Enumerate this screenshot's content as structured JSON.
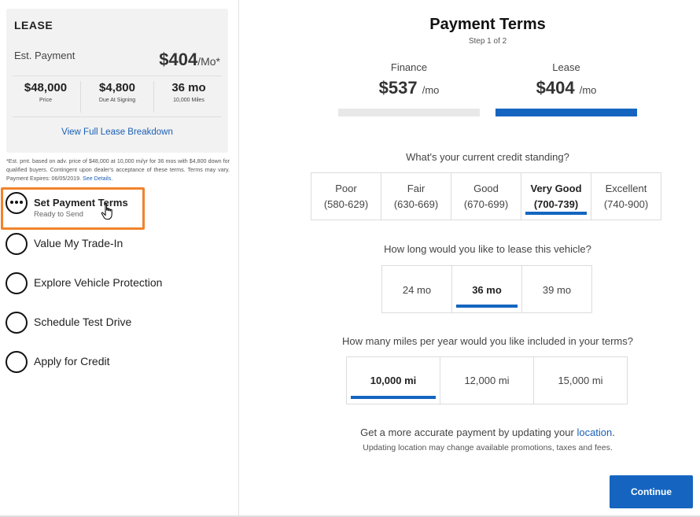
{
  "sidebar": {
    "card": {
      "title": "LEASE",
      "est_label": "Est. Payment",
      "est_value": "$404",
      "est_unit": "/Mo*",
      "stats": [
        {
          "value": "$48,000",
          "label": "Price"
        },
        {
          "value": "$4,800",
          "label": "Due At Signing"
        },
        {
          "value": "36 mo",
          "label": "10,000 Miles"
        }
      ],
      "breakdown_link": "View Full Lease Breakdown"
    },
    "disclaimer": "*Est. pmt. based on adv. price of $48,000 at 10,000 mi/yr for 36 mos with $4,800 down for qualified buyers. Contingent upon dealer's acceptance of these terms. Terms may vary. Payment Expires: 06/05/2019.",
    "disclaimer_link": "See Details.",
    "steps": [
      {
        "label": "Set Payment Terms",
        "sub": "Ready to Send"
      },
      {
        "label": "Value My Trade-In"
      },
      {
        "label": "Explore Vehicle Protection"
      },
      {
        "label": "Schedule Test Drive"
      },
      {
        "label": "Apply for Credit"
      }
    ]
  },
  "main": {
    "title": "Payment Terms",
    "step_indicator": "Step 1 of 2",
    "plans": [
      {
        "name": "Finance",
        "amount": "$537",
        "per": "/mo",
        "selected": false
      },
      {
        "name": "Lease",
        "amount": "$404",
        "per": "/mo",
        "selected": true
      }
    ],
    "credit_question": "What's your current credit standing?",
    "credit_options": [
      {
        "label": "Poor",
        "range": "(580-629)"
      },
      {
        "label": "Fair",
        "range": "(630-669)"
      },
      {
        "label": "Good",
        "range": "(670-699)"
      },
      {
        "label": "Very Good",
        "range": "(700-739)",
        "selected": true
      },
      {
        "label": "Excellent",
        "range": "(740-900)"
      }
    ],
    "term_question": "How long would you like to lease this vehicle?",
    "term_options": [
      "24 mo",
      "36 mo",
      "39 mo"
    ],
    "term_selected": "36 mo",
    "miles_question": "How many miles per year would you like included in your terms?",
    "miles_options": [
      "10,000 mi",
      "12,000 mi",
      "15,000 mi"
    ],
    "miles_selected": "10,000 mi",
    "location_text": "Get a more accurate payment by updating your",
    "location_link": "location",
    "location_period": ".",
    "location_sub": "Updating location may change available promotions, taxes and fees.",
    "continue_label": "Continue"
  },
  "colors": {
    "accent": "#1565c0",
    "highlight": "#f0832c",
    "link": "#1a5fb4"
  }
}
